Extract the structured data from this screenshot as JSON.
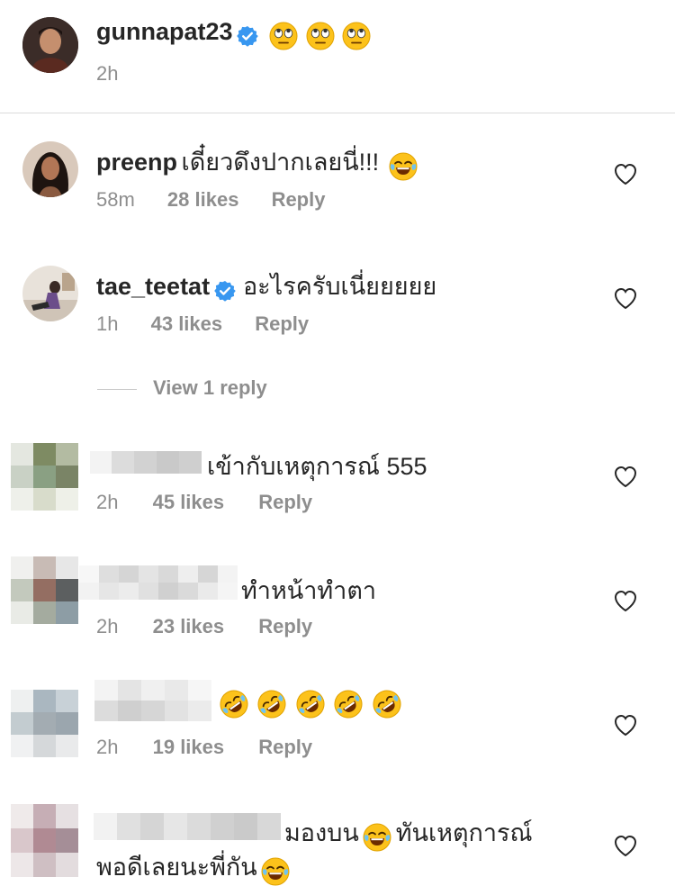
{
  "post": {
    "username": "gunnapat23",
    "verified": true,
    "time": "2h",
    "emoji_icons": [
      "face-with-rolling-eyes-icon",
      "face-with-rolling-eyes-icon",
      "face-with-rolling-eyes-icon"
    ]
  },
  "comments": [
    {
      "username": "preenp",
      "verified": false,
      "text": "เดี๋ยวดึงปากเลยนี่!!!",
      "emoji_icons": [
        "face-with-tears-of-joy-icon"
      ],
      "time": "58m",
      "likes": "28 likes",
      "reply": "Reply"
    },
    {
      "username": "tae_teetat",
      "verified": true,
      "text": "อะไรครับเนี่ยยยยย",
      "emoji_icons": [],
      "time": "1h",
      "likes": "43 likes",
      "reply": "Reply"
    },
    {
      "username": "",
      "text": "เข้ากับเหตุการณ์ 555",
      "emoji_icons": [],
      "time": "2h",
      "likes": "45 likes",
      "reply": "Reply"
    },
    {
      "username": "",
      "text": "ทำหน้าทำตา",
      "emoji_icons": [],
      "time": "2h",
      "likes": "23 likes",
      "reply": "Reply"
    },
    {
      "username": "",
      "text": "",
      "emoji_icons": [
        "rolling-on-floor-laughing-icon",
        "rolling-on-floor-laughing-icon",
        "rolling-on-floor-laughing-icon",
        "rolling-on-floor-laughing-icon",
        "rolling-on-floor-laughing-icon"
      ],
      "time": "2h",
      "likes": "19 likes",
      "reply": "Reply"
    },
    {
      "username": "",
      "text_part1": "มองบน",
      "text_part2": "ทันเหตุการณ์",
      "text_line2": "พอดีเลยนะพี่กัน",
      "emoji_icons": [
        "face-with-tears-of-joy-icon",
        "face-with-tears-of-joy-icon"
      ]
    }
  ],
  "view_replies": "View 1 reply",
  "colors": {
    "text": "#262626",
    "secondary": "#8e8e8e",
    "verified_blue": "#3897f0",
    "divider": "#dbdbdb",
    "emoji_yellow": "#fcc21b"
  }
}
